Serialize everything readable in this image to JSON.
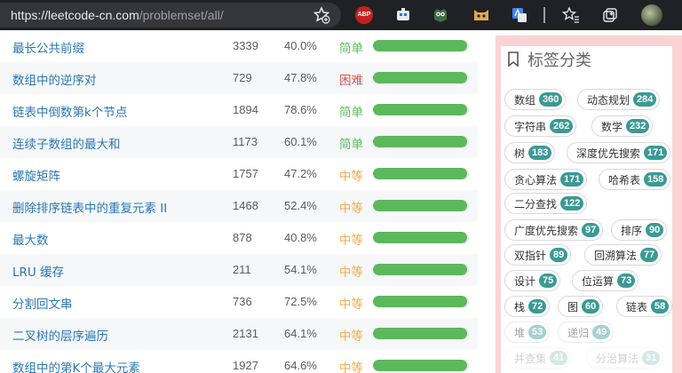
{
  "browser": {
    "url_host": "https://leetcode-cn.com",
    "url_path": "/problemset/all/"
  },
  "difficulty_colors": {
    "简单": "#5cb85c",
    "中等": "#f0ad4e",
    "困难": "#d9534f"
  },
  "problems": [
    {
      "title": "最长公共前缀",
      "count": "3339",
      "rate": "40.0%",
      "difficulty": "简单",
      "progress": 0.98
    },
    {
      "title": "数组中的逆序对",
      "count": "729",
      "rate": "47.8%",
      "difficulty": "困难",
      "progress": 0.98
    },
    {
      "title": "链表中倒数第k个节点",
      "count": "1894",
      "rate": "78.6%",
      "difficulty": "简单",
      "progress": 0.98
    },
    {
      "title": "连续子数组的最大和",
      "count": "1173",
      "rate": "60.1%",
      "difficulty": "简单",
      "progress": 0.98
    },
    {
      "title": "螺旋矩阵",
      "count": "1757",
      "rate": "47.2%",
      "difficulty": "中等",
      "progress": 0.98
    },
    {
      "title": "删除排序链表中的重复元素 II",
      "count": "1468",
      "rate": "52.4%",
      "difficulty": "中等",
      "progress": 0.98
    },
    {
      "title": "最大数",
      "count": "878",
      "rate": "40.8%",
      "difficulty": "中等",
      "progress": 0.98
    },
    {
      "title": "LRU 缓存",
      "count": "211",
      "rate": "54.1%",
      "difficulty": "中等",
      "progress": 0.98
    },
    {
      "title": "分割回文串",
      "count": "736",
      "rate": "72.5%",
      "difficulty": "中等",
      "progress": 0.98
    },
    {
      "title": "二叉树的层序遍历",
      "count": "2131",
      "rate": "64.1%",
      "difficulty": "中等",
      "progress": 0.98
    },
    {
      "title": "数组中的第K个最大元素",
      "count": "1927",
      "rate": "64.6%",
      "difficulty": "中等",
      "progress": 0.98
    }
  ],
  "tag_panel": {
    "title": "标签分类",
    "tags": [
      {
        "name": "数组",
        "count": "360"
      },
      {
        "name": "动态规划",
        "count": "284"
      },
      {
        "name": "字符串",
        "count": "262"
      },
      {
        "name": "数学",
        "count": "232"
      },
      {
        "name": "树",
        "count": "183"
      },
      {
        "name": "深度优先搜索",
        "count": "171"
      },
      {
        "name": "贪心算法",
        "count": "171"
      },
      {
        "name": "哈希表",
        "count": "158"
      },
      {
        "name": "二分查找",
        "count": "122"
      },
      {
        "name": "广度优先搜索",
        "count": "97"
      },
      {
        "name": "排序",
        "count": "90"
      },
      {
        "name": "双指针",
        "count": "89"
      },
      {
        "name": "回溯算法",
        "count": "77"
      },
      {
        "name": "设计",
        "count": "75"
      },
      {
        "name": "位运算",
        "count": "73"
      },
      {
        "name": "栈",
        "count": "72"
      },
      {
        "name": "图",
        "count": "60"
      },
      {
        "name": "链表",
        "count": "58"
      },
      {
        "name": "堆",
        "count": "53"
      },
      {
        "name": "递归",
        "count": "49"
      },
      {
        "name": "并查集",
        "count": "41"
      },
      {
        "name": "分治算法",
        "count": "31"
      }
    ]
  }
}
